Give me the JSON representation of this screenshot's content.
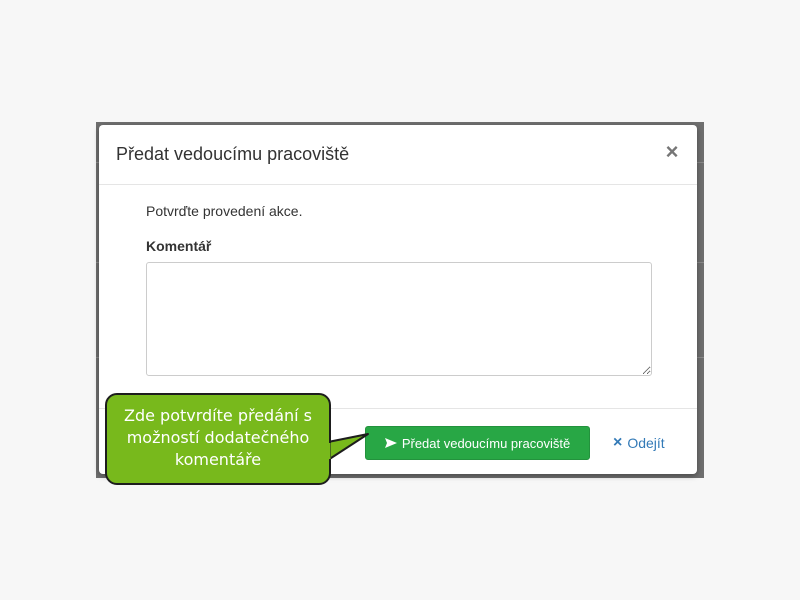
{
  "dialog": {
    "title": "Předat vedoucímu pracoviště",
    "close_label": "×",
    "confirm_text": "Potvrďte provedení akce.",
    "comment_label": "Komentář",
    "comment_value": "",
    "submit_label": "Předat vedoucímu pracoviště",
    "cancel_icon": "×",
    "cancel_label": "Odejít"
  },
  "callout": {
    "text": "Zde potvrdíte předání s možností dodatečného komentáře"
  },
  "colors": {
    "submit_bg": "#28a745",
    "link": "#337ab7",
    "callout_bg": "#78b91c"
  },
  "icons": {
    "close": "close-icon",
    "submit": "send-icon",
    "cancel": "cancel-icon"
  }
}
